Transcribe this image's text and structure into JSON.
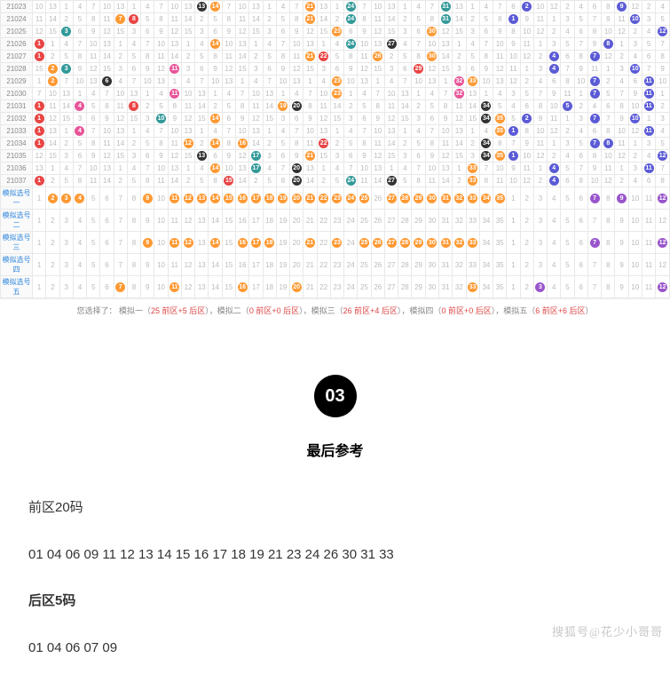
{
  "issues": [
    "21023",
    "21024",
    "21025",
    "21026",
    "21027",
    "21028",
    "21029",
    "21030",
    "21031",
    "21032",
    "21033",
    "21034",
    "21035",
    "21036",
    "21037"
  ],
  "sim_labels": [
    "模拟选号一",
    "模拟选号二",
    "模拟选号三",
    "模拟选号四",
    "模拟选号五"
  ],
  "footer_hint": "您选择了：",
  "footer_parts": [
    {
      "label": "模拟一（",
      "detail": "25 前区+5 后区",
      "tail": "），"
    },
    {
      "label": "模拟二（",
      "detail": "0 前区+0 后区",
      "tail": "），"
    },
    {
      "label": "模拟三（",
      "detail": "26 前区+4 后区",
      "tail": "），"
    },
    {
      "label": "模拟四（",
      "detail": "0 前区+0 后区",
      "tail": "），"
    },
    {
      "label": "模拟五（",
      "detail": "6 前区+6 后区",
      "tail": "）"
    }
  ],
  "badge": "03",
  "section_title": "最后参考",
  "front_label": "前区20码",
  "front_numbers": "01 04 06 09 11 12 13 14 15 16 17 18 19 21 23 24 26 30 31 33",
  "back_label": "后区5码",
  "back_numbers": "01 04 06 07 09",
  "watermark": "搜狐号@花少小哥哥",
  "chart_data": {
    "type": "table",
    "description": "Lottery trend chart showing drawn numbers per issue across front zone (1-35) and back zone (1-12). Highlighted balls indicate drawn numbers; gray numbers are miss counts.",
    "front_zone_range": [
      1,
      35
    ],
    "back_zone_range": [
      1,
      12
    ],
    "rows": [
      {
        "issue": "21023",
        "front": [
          13,
          14,
          21,
          24,
          31
        ],
        "back": [
          2,
          9
        ]
      },
      {
        "issue": "21024",
        "front": [
          7,
          8,
          21,
          24,
          31
        ],
        "back": [
          1,
          10
        ]
      },
      {
        "issue": "21025",
        "front": [
          3,
          23,
          30
        ],
        "back": [
          12
        ]
      },
      {
        "issue": "21026",
        "front": [
          1,
          14,
          24,
          27
        ],
        "back": [
          8
        ]
      },
      {
        "issue": "21027",
        "front": [
          1,
          21,
          22,
          26,
          30
        ],
        "back": [
          4,
          7
        ]
      },
      {
        "issue": "21028",
        "front": [
          2,
          3,
          11,
          29
        ],
        "back": [
          4,
          10
        ]
      },
      {
        "issue": "21029",
        "front": [
          2,
          6,
          23,
          32,
          33
        ],
        "back": [
          7,
          11
        ]
      },
      {
        "issue": "21030",
        "front": [
          11,
          23,
          32
        ],
        "back": [
          7,
          11
        ]
      },
      {
        "issue": "21031",
        "front": [
          1,
          4,
          8,
          19,
          20,
          34
        ],
        "back": [
          5,
          11
        ]
      },
      {
        "issue": "21032",
        "front": [
          1,
          10,
          14,
          34,
          35
        ],
        "back": [
          2,
          7,
          10
        ]
      },
      {
        "issue": "21033",
        "front": [
          1,
          4,
          35
        ],
        "back": [
          1,
          11
        ]
      },
      {
        "issue": "21034",
        "front": [
          1,
          12,
          14,
          16,
          22,
          34
        ],
        "back": [
          7,
          8
        ]
      },
      {
        "issue": "21035",
        "front": [
          13,
          17,
          21,
          34,
          35
        ],
        "back": [
          1,
          12
        ]
      },
      {
        "issue": "21036",
        "front": [
          14,
          17,
          20,
          33
        ],
        "back": [
          4,
          11
        ]
      },
      {
        "issue": "21037",
        "front": [
          1,
          15,
          20,
          24,
          27,
          33
        ],
        "back": [
          4
        ]
      }
    ],
    "simulations": [
      {
        "label": "模拟选号一",
        "front": [
          2,
          3,
          4,
          9,
          11,
          12,
          13,
          14,
          15,
          16,
          17,
          18,
          19,
          20,
          21,
          22,
          23,
          24,
          25,
          27,
          28,
          29,
          30,
          31,
          32,
          33,
          34,
          35
        ],
        "back": [
          7,
          9,
          12
        ]
      },
      {
        "label": "模拟选号二",
        "front": [],
        "back": []
      },
      {
        "label": "模拟选号三",
        "front": [
          9,
          11,
          12,
          14,
          16,
          17,
          18,
          21,
          23,
          25,
          26,
          27,
          28,
          29,
          30,
          31,
          32,
          33
        ],
        "back": [
          7,
          12
        ]
      },
      {
        "label": "模拟选号四",
        "front": [],
        "back": []
      },
      {
        "label": "模拟选号五",
        "front": [
          7,
          11,
          16,
          20,
          33
        ],
        "back": [
          3,
          12
        ]
      }
    ]
  }
}
